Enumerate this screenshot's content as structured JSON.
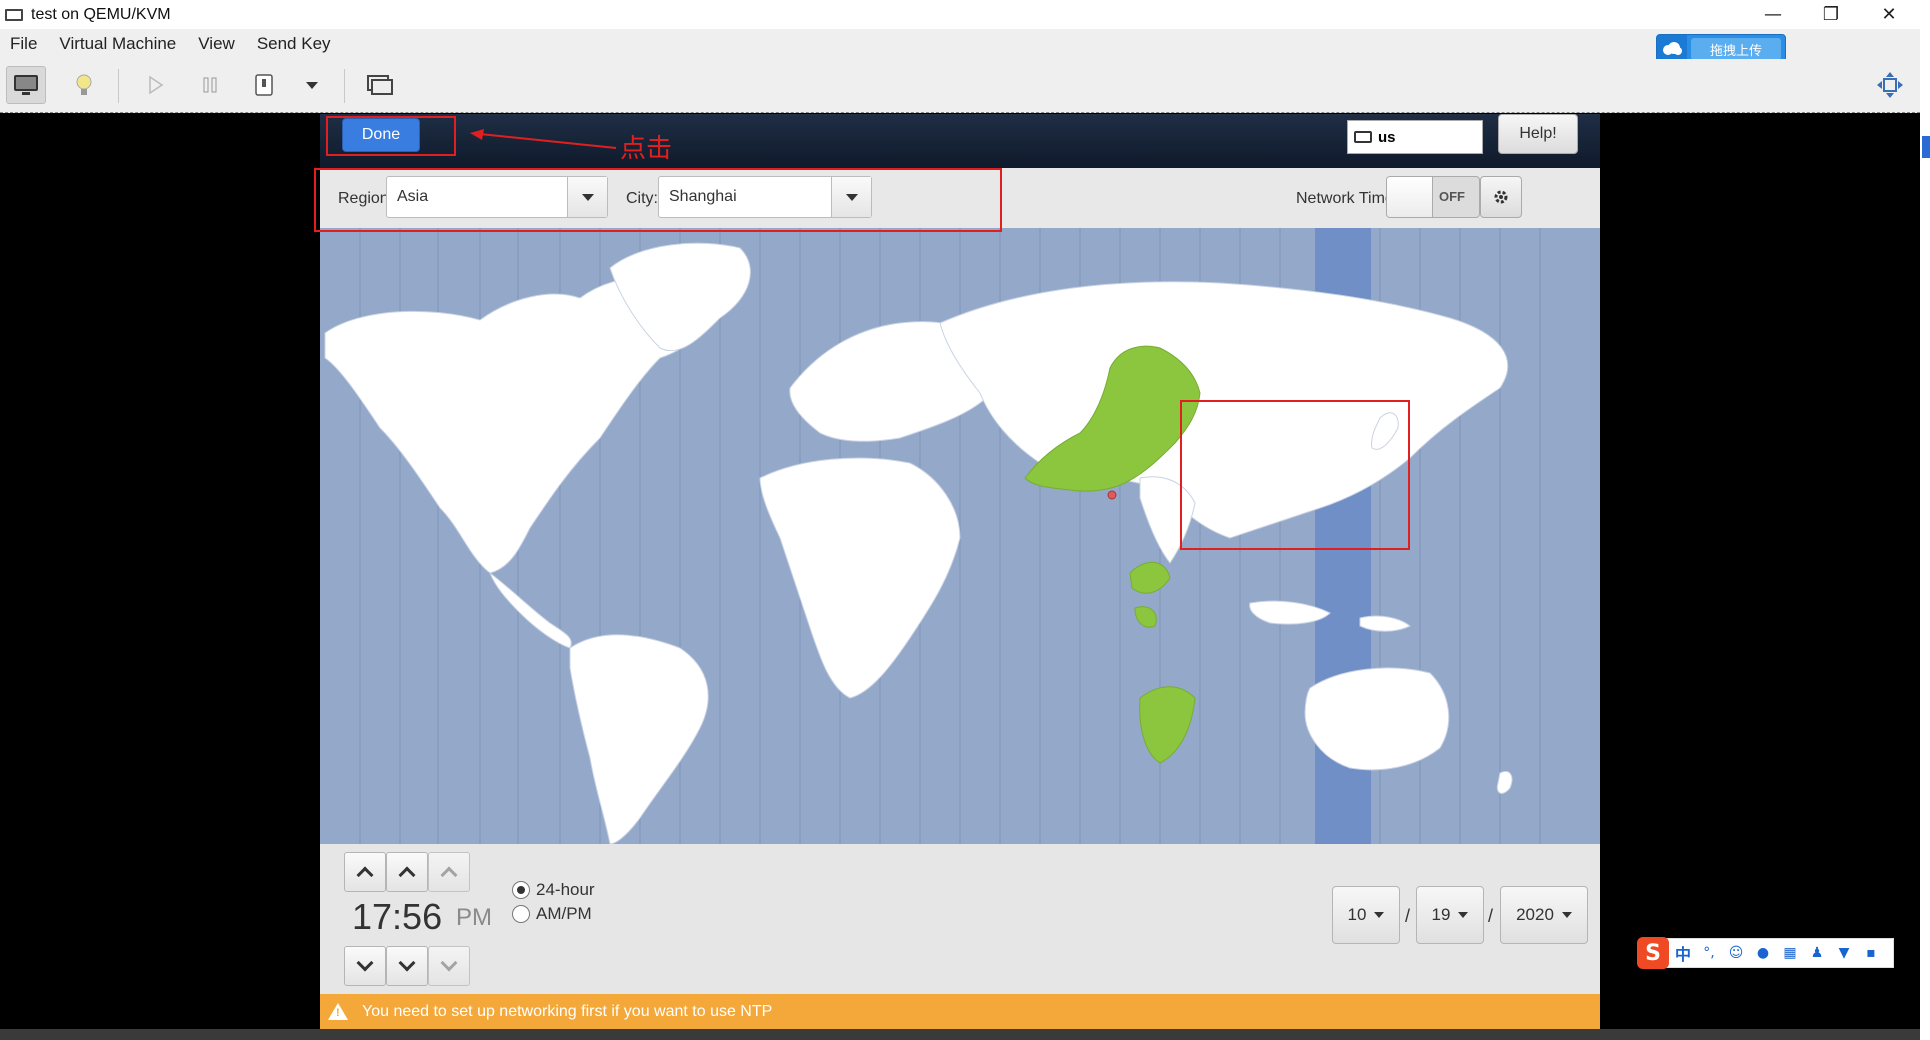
{
  "window": {
    "title": "test on QEMU/KVM",
    "controls": {
      "minimize": "—",
      "restore": "❐",
      "close": "✕"
    }
  },
  "menu": [
    "File",
    "Virtual Machine",
    "View",
    "Send Key"
  ],
  "toolbar": {
    "items": [
      "console-icon",
      "details-icon",
      "run-icon",
      "pause-icon",
      "shutdown-icon",
      "dropdown-icon",
      "snapshot-icon"
    ],
    "fullscreen": "fullscreen-icon"
  },
  "upload_widget": {
    "label": "拖拽上传"
  },
  "installer": {
    "done_label": "Done",
    "keyboard_layout": "us",
    "help_label": "Help!",
    "region_label": "Region:",
    "region_value": "Asia",
    "city_label": "City:",
    "city_value": "Shanghai",
    "network_time_label": "Network Time",
    "network_time_state": "OFF",
    "time": {
      "display": "17:56",
      "ampm": "PM",
      "format_24": "24-hour",
      "format_ampm": "AM/PM",
      "selected_format": "24-hour"
    },
    "date": {
      "month": "10",
      "day": "19",
      "year": "2020",
      "separator": "/"
    },
    "warning": "You need to set up networking first if you want to use NTP"
  },
  "annotation": {
    "text": "点击",
    "color": "#e02020"
  },
  "ime": {
    "logo": "S",
    "lang": "中",
    "punct": "°,"
  },
  "colors": {
    "accent": "#3a7de0",
    "map_sea": "#94a8c9",
    "map_land": "#ffffff",
    "selected_zone": "#8cc63f",
    "warning": "#f5a83a",
    "annotation": "#e02020"
  }
}
